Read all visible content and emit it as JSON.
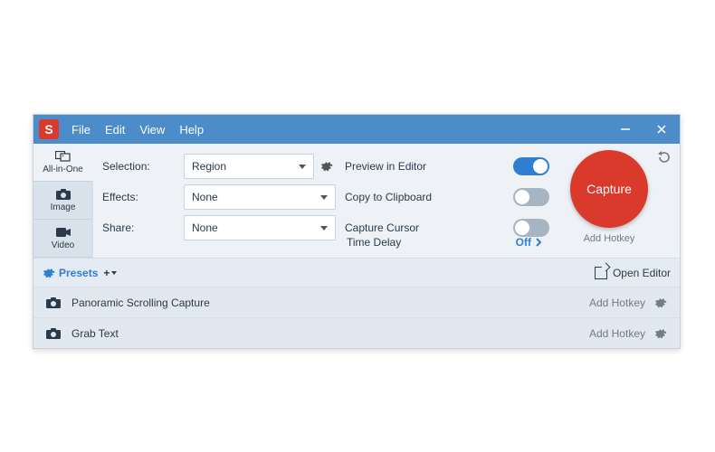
{
  "titlebar": {
    "app_glyph": "S",
    "menu": [
      "File",
      "Edit",
      "View",
      "Help"
    ]
  },
  "tabs": {
    "all_in_one": "All-in-One",
    "image": "Image",
    "video": "Video"
  },
  "options": {
    "selection_label": "Selection:",
    "selection_value": "Region",
    "effects_label": "Effects:",
    "effects_value": "None",
    "share_label": "Share:",
    "share_value": "None",
    "preview_label": "Preview in Editor",
    "preview_on": true,
    "copy_label": "Copy to Clipboard",
    "copy_on": false,
    "cursor_label": "Capture Cursor",
    "cursor_on": false,
    "delay_label": "Time Delay",
    "delay_value": "Off",
    "capture_label": "Capture",
    "add_hotkey": "Add Hotkey"
  },
  "presets_bar": {
    "presets": "Presets",
    "open_editor": "Open Editor"
  },
  "presets": [
    {
      "name": "Panoramic Scrolling Capture",
      "hotkey": "Add Hotkey"
    },
    {
      "name": "Grab Text",
      "hotkey": "Add Hotkey"
    }
  ]
}
